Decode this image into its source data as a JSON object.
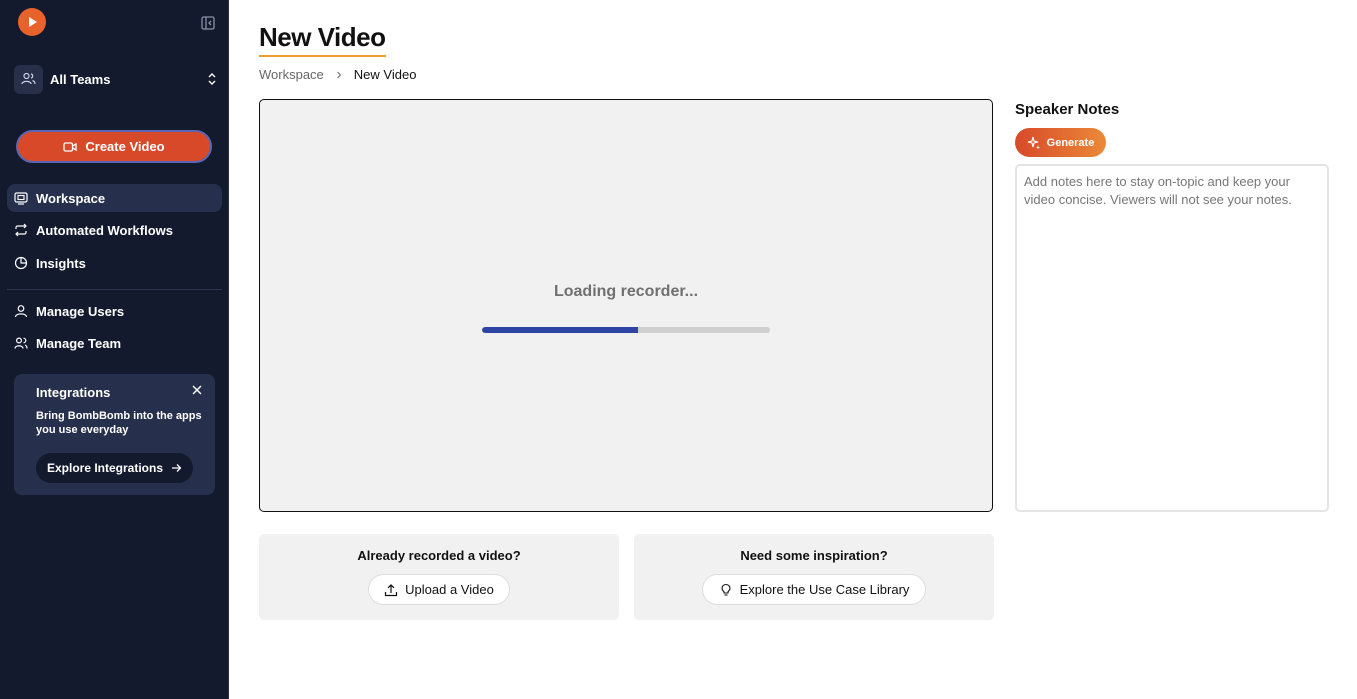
{
  "sidebar": {
    "team_name": "All Teams",
    "create_label": "Create Video",
    "nav": [
      {
        "label": "Workspace"
      },
      {
        "label": "Automated Workflows"
      },
      {
        "label": "Insights"
      },
      {
        "label": "Manage Users"
      },
      {
        "label": "Manage Team"
      }
    ],
    "integrations": {
      "title": "Integrations",
      "description": "Bring BombBomb into the apps you use everyday",
      "button_label": "Explore Integrations"
    }
  },
  "header": {
    "title": "New Video",
    "breadcrumb": [
      "Workspace",
      "New Video"
    ]
  },
  "recorder": {
    "loading_text": "Loading recorder...",
    "progress": 0.54
  },
  "cards": [
    {
      "title": "Already recorded a video?",
      "button_label": "Upload a Video"
    },
    {
      "title": "Need some inspiration?",
      "button_label": "Explore the Use Case Library"
    }
  ],
  "notes": {
    "title": "Speaker Notes",
    "generate_label": "Generate",
    "placeholder": "Add notes here to stay on-topic and keep your video concise. Viewers will not see your notes."
  },
  "colors": {
    "sidebar_bg": "#141a2e",
    "accent": "#d8492a",
    "progress": "#2f45a6",
    "title_underline": "#e8a02a"
  },
  "icons": [
    "logo-play-icon",
    "collapse-sidebar-icon",
    "users-icon",
    "chevron-up-down-icon",
    "video-camera-icon",
    "workspace-icon",
    "workflow-arrows-icon",
    "pie-chart-icon",
    "user-icon",
    "team-icon",
    "close-icon",
    "arrow-right-icon",
    "chevron-right-icon",
    "upload-icon",
    "lightbulb-icon",
    "sparkle-icon"
  ]
}
